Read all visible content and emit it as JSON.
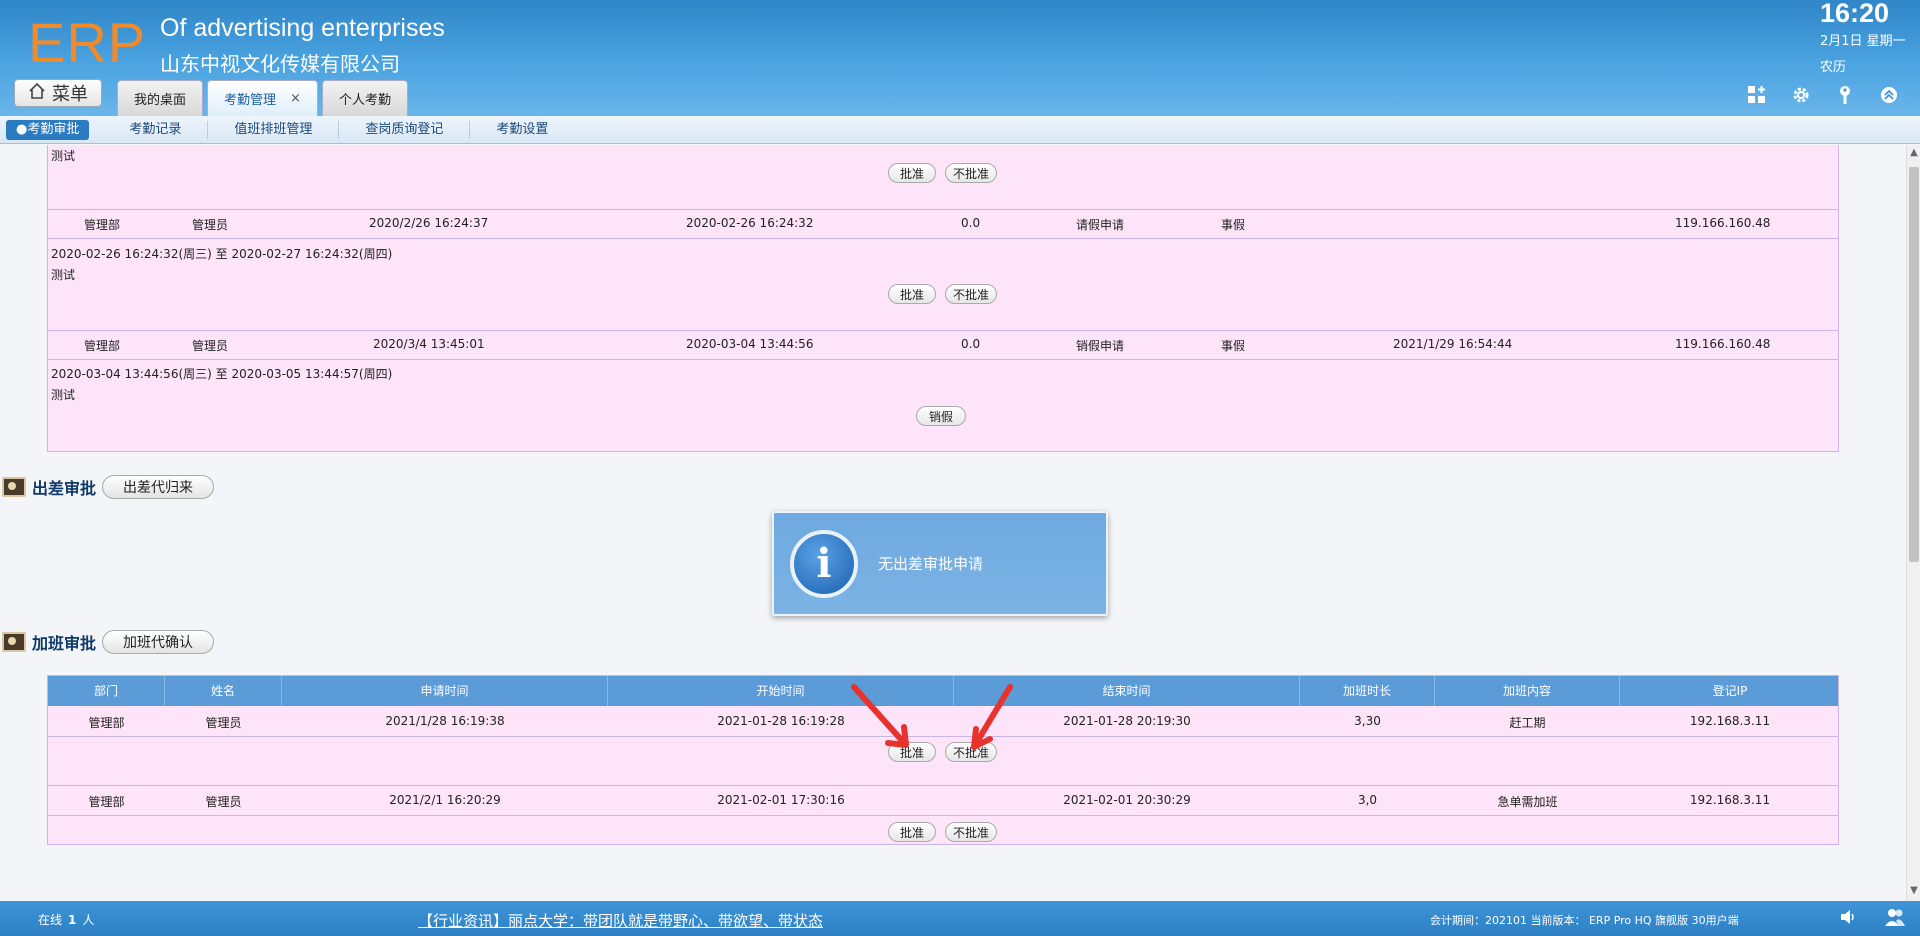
{
  "header": {
    "logo": "ERP",
    "company_en": "Of advertising enterprises",
    "company_cn": "山东中视文化传媒有限公司",
    "menu_label": "菜单",
    "time": "16:20",
    "date": "2月1日 星期一",
    "lunar": "农历",
    "tabs": [
      {
        "label": "我的桌面",
        "active": false
      },
      {
        "label": "考勤管理",
        "active": true,
        "close": "×"
      },
      {
        "label": "个人考勤",
        "active": false
      }
    ],
    "icons": [
      "grid-plus-icon",
      "gear-icon",
      "key-icon",
      "chevron-up-circle-icon"
    ]
  },
  "subnav": {
    "items": [
      "●考勤审批",
      "考勤记录",
      "值班排班管理",
      "查岗质询登记",
      "考勤设置"
    ]
  },
  "leave": {
    "top_note": "测试",
    "approve": "批准",
    "reject": "不批准",
    "cancel_leave": "销假",
    "rows": [
      {
        "dept": "管理部",
        "name": "管理员",
        "apply_time": "2020/2/26 16:24:37",
        "start": "2020-02-26 16:24:32",
        "hours": "0.0",
        "type": "请假申请",
        "kind": "事假",
        "cancel_time": "",
        "ip": "119.166.160.48",
        "range": "2020-02-26 16:24:32(周三) 至 2020-02-27 16:24:32(周四)",
        "note": "测试"
      },
      {
        "dept": "管理部",
        "name": "管理员",
        "apply_time": "2020/3/4 13:45:01",
        "start": "2020-03-04 13:44:56",
        "hours": "0.0",
        "type": "销假申请",
        "kind": "事假",
        "cancel_time": "2021/1/29 16:54:44",
        "ip": "119.166.160.48",
        "range": "2020-03-04 13:44:56(周三) 至 2020-03-05 13:44:57(周四)",
        "note": "测试"
      }
    ]
  },
  "business_trip": {
    "title": "出差审批",
    "button": "出差代归来",
    "empty_message": "无出差审批申请"
  },
  "overtime": {
    "title": "加班审批",
    "button": "加班代确认",
    "headers": [
      "部门",
      "姓名",
      "申请时间",
      "开始时间",
      "结束时间",
      "加班时长",
      "加班内容",
      "登记IP"
    ],
    "rows": [
      [
        "管理部",
        "管理员",
        "2021/1/28 16:19:38",
        "2021-01-28 16:19:28",
        "2021-01-28 20:19:30",
        "3,30",
        "赶工期",
        "192.168.3.11"
      ],
      [
        "管理部",
        "管理员",
        "2021/2/1 16:20:29",
        "2021-02-01 17:30:16",
        "2021-02-01 20:30:29",
        "3,0",
        "急单需加班",
        "192.168.3.11"
      ]
    ],
    "approve": "批准",
    "reject": "不批准"
  },
  "footer": {
    "online_label": "在线",
    "online_count": "1",
    "online_unit": "人",
    "news": "【行业资讯】丽点大学：带团队就是带野心、带欲望、带状态",
    "account": "会计期间：202101  当前版本： ERP Pro HQ 旗舰版 30用户端"
  },
  "colors": {
    "header_blue": "#3f95d8",
    "logo_orange": "#f08a2b",
    "row_pink": "#fde4f8",
    "table_head_blue": "#5b9bd8",
    "arrow_red": "#e8322e"
  }
}
